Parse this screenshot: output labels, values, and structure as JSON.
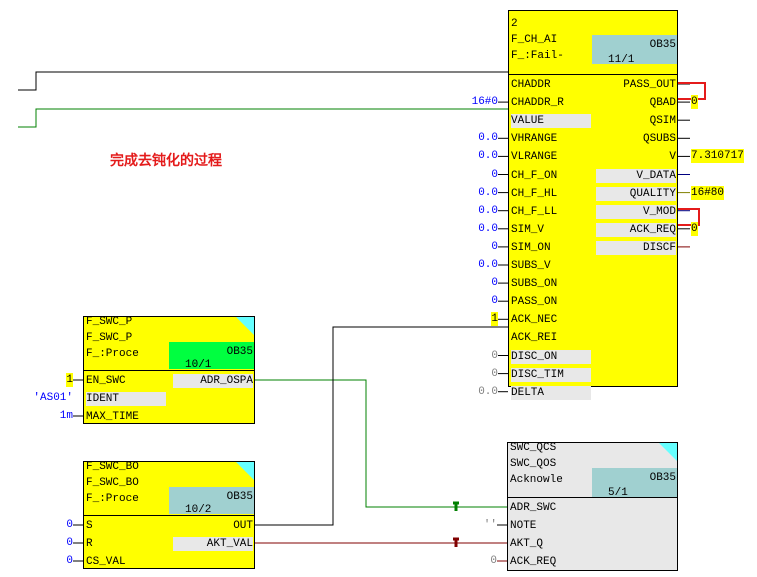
{
  "annotation": "完成去钝化的过程",
  "colors": {
    "block": "#ffff00",
    "block_grey": "#e8e8e8",
    "tag_teal": "#a0d0d0",
    "tag_green": "#00ff40",
    "highlight_box": "#e41b1b",
    "wire_green": "#008000",
    "wire_red": "#800000"
  },
  "blocks": [
    {
      "id": "f-ch-ai",
      "header": [
        "2",
        "F_CH_AI",
        "F_:Fail-"
      ],
      "tag": {
        "ob": "OB35",
        "num": "11/1",
        "color": "#a0d0d0"
      },
      "inputs": [
        {
          "name": "CHADDR",
          "value": "",
          "style": "none"
        },
        {
          "name": "CHADDR_R",
          "value": "16#0",
          "style": "blue"
        },
        {
          "name": "VALUE",
          "value": "",
          "style": "none",
          "grey": true
        },
        {
          "name": "VHRANGE",
          "value": "0.0",
          "style": "blue"
        },
        {
          "name": "VLRANGE",
          "value": "0.0",
          "style": "blue"
        },
        {
          "name": "CH_F_ON",
          "value": "0",
          "style": "blue"
        },
        {
          "name": "CH_F_HL",
          "value": "0.0",
          "style": "blue"
        },
        {
          "name": "CH_F_LL",
          "value": "0.0",
          "style": "blue"
        },
        {
          "name": "SIM_V",
          "value": "0.0",
          "style": "blue"
        },
        {
          "name": "SIM_ON",
          "value": "0",
          "style": "blue"
        },
        {
          "name": "SUBS_V",
          "value": "0.0",
          "style": "blue"
        },
        {
          "name": "SUBS_ON",
          "value": "0",
          "style": "blue"
        },
        {
          "name": "PASS_ON",
          "value": "0",
          "style": "blue"
        },
        {
          "name": "ACK_NEC",
          "value": "1",
          "style": "hl"
        },
        {
          "name": "ACK_REI",
          "value": "",
          "style": "none"
        },
        {
          "name": "DISC_ON",
          "value": "0",
          "style": "grey",
          "grey": true
        },
        {
          "name": "DISC_TIM",
          "value": "0",
          "style": "grey",
          "grey": true
        },
        {
          "name": "DELTA",
          "value": "0.0",
          "style": "grey",
          "grey": true
        }
      ],
      "outputs": [
        {
          "name": "PASS_OUT",
          "value": "",
          "style": "none"
        },
        {
          "name": "QBAD",
          "value": "0",
          "style": "hl"
        },
        {
          "name": "QSIM",
          "value": "",
          "style": "none"
        },
        {
          "name": "QSUBS",
          "value": "",
          "style": "none"
        },
        {
          "name": "V",
          "value": " 7.310717",
          "style": "hl"
        },
        {
          "name": "V_DATA",
          "value": "",
          "style": "none",
          "grey": true
        },
        {
          "name": "QUALITY",
          "value": "16#80",
          "style": "hl",
          "grey": true
        },
        {
          "name": "V_MOD",
          "value": "",
          "style": "none",
          "grey": true
        },
        {
          "name": "ACK_REQ",
          "value": "0",
          "style": "hl",
          "grey": true
        },
        {
          "name": "DISCF",
          "value": "",
          "style": "none",
          "grey": true
        }
      ]
    },
    {
      "id": "f-swc-p",
      "header": [
        "F_SWC_P",
        "F_SWC_P",
        "F_:Proce"
      ],
      "tag": {
        "ob": "OB35",
        "num": "10/1",
        "color": "#00ff40"
      },
      "inputs": [
        {
          "name": "EN_SWC",
          "value": "1",
          "style": "hl"
        },
        {
          "name": "IDENT",
          "value": "'AS01'",
          "style": "blue",
          "grey": true
        },
        {
          "name": "MAX_TIME",
          "value": "1m",
          "style": "blue"
        }
      ],
      "outputs": [
        {
          "name": "ADR_OSPA",
          "value": "",
          "style": "none",
          "grey": true
        }
      ]
    },
    {
      "id": "f-swc-bo",
      "header": [
        "F_SWC_BO",
        "F_SWC_BO",
        "F_:Proce"
      ],
      "tag": {
        "ob": "OB35",
        "num": "10/2",
        "color": "#a0d0d0"
      },
      "inputs": [
        {
          "name": "S",
          "value": "0",
          "style": "blue"
        },
        {
          "name": "R",
          "value": "0",
          "style": "blue"
        },
        {
          "name": "CS_VAL",
          "value": "0",
          "style": "blue"
        }
      ],
      "outputs": [
        {
          "name": "OUT",
          "value": "",
          "style": "none"
        },
        {
          "name": "AKT_VAL",
          "value": "",
          "style": "none",
          "grey": true
        }
      ]
    },
    {
      "id": "swc-qcs",
      "header": [
        "SWC_QCS",
        "SWC_QOS",
        "Acknowle"
      ],
      "tag": {
        "ob": "OB35",
        "num": "5/1",
        "color": "#a0d0d0"
      },
      "inputs": [
        {
          "name": "ADR_SWC",
          "value": "",
          "style": "none"
        },
        {
          "name": "NOTE",
          "value": "''",
          "style": "grey"
        },
        {
          "name": "AKT_Q",
          "value": "",
          "style": "none"
        },
        {
          "name": "ACK_REQ",
          "value": "0",
          "style": "grey"
        }
      ],
      "outputs": []
    }
  ]
}
